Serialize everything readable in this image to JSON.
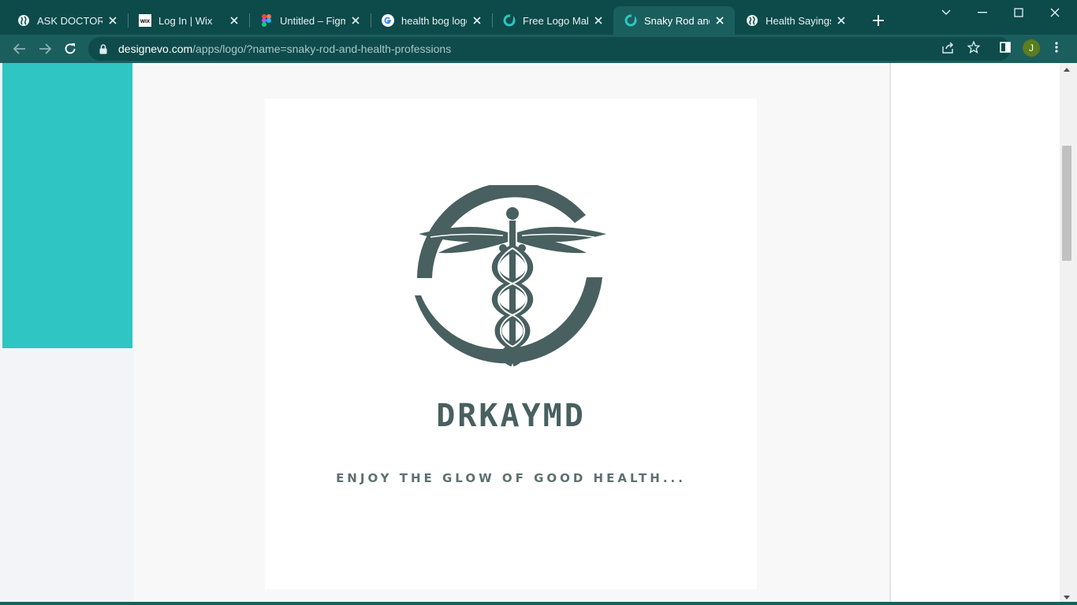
{
  "tabs": [
    {
      "title": "ASK DOCTOR KAY",
      "icon": "globe-icon"
    },
    {
      "title": "Log In | Wix",
      "icon": "wix-icon",
      "icon_text": "WIX"
    },
    {
      "title": "Untitled – Figma",
      "icon": "figma-icon"
    },
    {
      "title": "health bog logo - Google Search",
      "icon": "google-icon"
    },
    {
      "title": "Free Logo Maker",
      "icon": "designevo-icon"
    },
    {
      "title": "Snaky Rod and Health Professions",
      "icon": "designevo-icon",
      "active": true
    },
    {
      "title": "Health Sayings & Quotes",
      "icon": "globe-icon"
    }
  ],
  "address_bar": {
    "domain": "designevo.com",
    "path": "/apps/logo/?name=snaky-rod-and-health-professions"
  },
  "profile": {
    "initial": "J",
    "color": "#5a7d1e"
  },
  "logo": {
    "name": "DRKAYMD",
    "tagline": "ENJOY THE GLOW OF GOOD HEALTH...",
    "emblem": "caduceus-icon",
    "color": "#48605f"
  },
  "colors": {
    "chrome_dark": "#0d4a4a",
    "chrome_toolbar": "#1b5e5e",
    "sidebar_teal": "#2fc5c2"
  }
}
